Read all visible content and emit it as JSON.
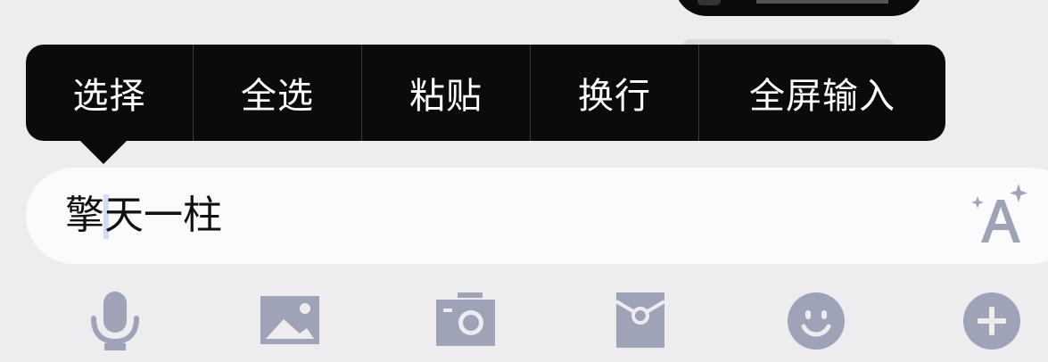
{
  "context_menu": {
    "items": [
      "选择",
      "全选",
      "粘贴",
      "换行",
      "全屏输入"
    ]
  },
  "input": {
    "value": "擎天一柱"
  },
  "toolbar": {
    "icons": [
      "microphone-icon",
      "image-icon",
      "camera-icon",
      "red-packet-icon",
      "emoji-icon",
      "plus-icon"
    ]
  },
  "colors": {
    "menu_bg": "#0b0b0b",
    "icon_gray": "#9fa3b8",
    "page_bg": "#ededf0",
    "input_bg": "#fbfbfd"
  }
}
